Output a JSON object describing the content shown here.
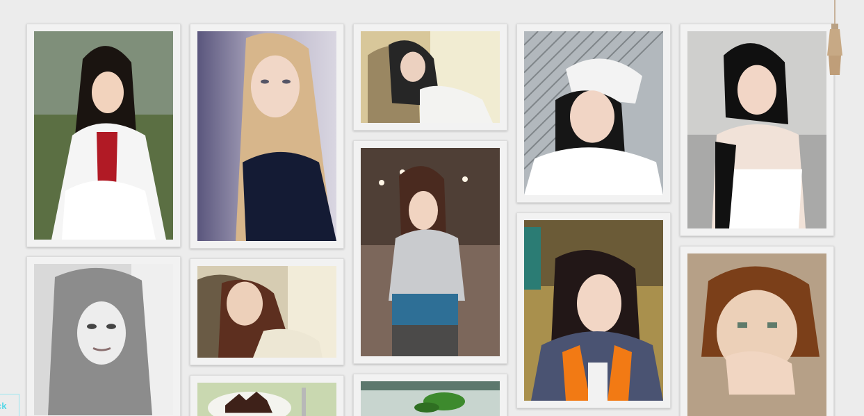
{
  "page": {
    "background": "#ececec",
    "back_link_label": "ck",
    "accent": "#56d7e6"
  },
  "gallery": {
    "cards": [
      {
        "name": "photo-card-1",
        "subject": "woman-white-jacket"
      },
      {
        "name": "photo-card-2",
        "subject": "blonde-woman-portrait"
      },
      {
        "name": "photo-card-3",
        "subject": "woman-sleeping-chair"
      },
      {
        "name": "photo-card-4",
        "subject": "woman-white-beanie"
      },
      {
        "name": "photo-card-5",
        "subject": "woman-black-dress"
      },
      {
        "name": "photo-card-6",
        "subject": "bw-woman-portrait"
      },
      {
        "name": "photo-card-7",
        "subject": "woman-sleeping-close"
      },
      {
        "name": "photo-card-8",
        "subject": "woman-grey-hoodie"
      },
      {
        "name": "photo-card-9",
        "subject": "woman-orange-jacket"
      },
      {
        "name": "photo-card-10",
        "subject": "woman-short-hair"
      },
      {
        "name": "photo-card-11",
        "subject": "cake-plate"
      },
      {
        "name": "photo-card-12",
        "subject": "plant-window"
      }
    ]
  },
  "decor": {
    "tassel_icon": "tassel-icon"
  }
}
